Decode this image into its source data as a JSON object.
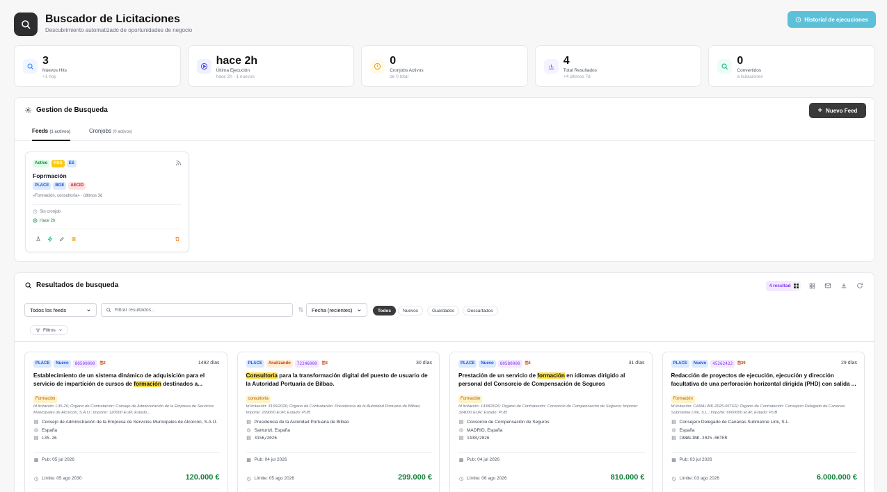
{
  "header": {
    "title": "Buscador de Licitaciones",
    "subtitle": "Descubrimiento automatizado de oportunidades de negocio",
    "history_button": "Historial de ejecuciones"
  },
  "stats": [
    {
      "value": "3",
      "label": "Nuevos Hits",
      "sub": "+1 hoy",
      "color": "#3b82f6",
      "bg": "#eff6ff"
    },
    {
      "value": "hace 2h",
      "label": "Última Ejecución",
      "sub": "hace 2h · 1 nuevos",
      "color": "#4f46e5",
      "bg": "#eef2ff"
    },
    {
      "value": "0",
      "label": "Cronjobs Activos",
      "sub": "de 0 total",
      "color": "#f59e0b",
      "bg": "#fffbeb"
    },
    {
      "value": "4",
      "label": "Total Resultados",
      "sub": "+4 últimos 7d",
      "color": "#8b5cf6",
      "bg": "#f5f3ff"
    },
    {
      "value": "0",
      "label": "Convertidos",
      "sub": "a licitaciones",
      "color": "#10b981",
      "bg": "#ecfdf5"
    }
  ],
  "gestion": {
    "title": "Gestion de Busqueda",
    "new_feed": "Nuevo Feed",
    "tabs": [
      {
        "label": "Feeds",
        "count": "(1 activos)"
      },
      {
        "label": "Cronjobs",
        "count": "(0 activos)"
      }
    ],
    "feed": {
      "status": "Activo",
      "type": "RSS",
      "lang": "ES",
      "name": "Foprmación",
      "sources": [
        "PLACE",
        "BOE",
        "AECID"
      ],
      "query": "«Formación, consultoría» · últimos 3d",
      "cron": "Sin cronjob",
      "last_run": "Hace 2h"
    }
  },
  "results": {
    "title": "Resultados de busqueda",
    "count_badge": "4 resultados",
    "feed_select": "Todos los feeds",
    "search_placeholder": "Filtrar resultados...",
    "sort_select": "Fecha (recientes)",
    "filters": [
      "Todos",
      "Nuevos",
      "Guardados",
      "Descartados"
    ],
    "filtros_label": "Filtros",
    "cards": [
      {
        "source": "PLACE",
        "status": "Nuevo",
        "code": "80500000",
        "docs": "2",
        "days": "1492 días",
        "title_pre": "Establecimiento de un sistema dinámico de adquisición para el servicio de impartición de cursos de ",
        "title_hl": "formación",
        "title_post": " destinados a...",
        "hl_first": false,
        "tag": "Formación",
        "desc": "Id licitación: L35-26; Órgano de Contratación: Consejo de Administración de la Empresa de Servicios Municipales de Alcorcón, S.A.U.; Importe: 120000 EUR; Estado...",
        "organ": "Consejo de Administración de la Empresa de Servicios Municipales de Alcorcón, S.A.U.",
        "location": "España",
        "ref": "L35-26",
        "pub": "Pub: 05 jul 2026",
        "limit": "Límite: 05 ago 2030",
        "amount": "120.000 €"
      },
      {
        "source": "PLACE",
        "status": "Analizando",
        "code": "72246000",
        "docs": "3",
        "days": "30 días",
        "title_pre": "",
        "title_hl": "Consultoría",
        "title_post": " para la transformación digital del puesto de usuario de la Autoridad Portuaria de Bilbao.",
        "hl_first": true,
        "tag": "consultoría",
        "desc": "Id licitación: 3156/2026; Órgano de Contratación: Presidencia de la Autoridad Portuaria de Bilbao; Importe: 299000 EUR; Estado: PUB",
        "organ": "Presidencia de la Autoridad Portuaria de Bilbao",
        "location": "Santurtzi, España",
        "ref": "3156/2026",
        "pub": "Pub: 04 jul 2026",
        "limit": "Límite: 05 ago 2026",
        "amount": "299.000 €"
      },
      {
        "source": "PLACE",
        "status": "Nuevo",
        "code": "80580000",
        "docs": "4",
        "days": "31 días",
        "title_pre": "Prestación de un servicio de ",
        "title_hl": "formación",
        "title_post": " en idiomas dirigido al personal del Consorcio de Compensación de Seguros",
        "hl_first": false,
        "tag": "Formación",
        "desc": "Id licitación: 1438/2026; Órgano de Contratación: Consorcio de Compensación de Seguros; Importe: 324000 EUR; Estado: PUB",
        "organ": "Consorcio de Compensación de Seguros",
        "location": "MADRID, España",
        "ref": "1438/2026",
        "pub": "Pub: 04 jul 2026",
        "limit": "Límite: 06 ago 2026",
        "amount": "810.000 €"
      },
      {
        "source": "PLACE",
        "status": "Nuevo",
        "code": "45262422",
        "docs": "39",
        "days": "29 días",
        "title_pre": "Redacción de proyectos de ejecución, ejecución y dirección facultativa de una perforación horizontal dirigida (PHD) con salida ...",
        "title_hl": "",
        "title_post": "",
        "hl_first": false,
        "tag": "Formación",
        "desc": "Id licitación: CANALINK-2025-06TER; Órgano de Contratación: Consejero Delegado de Canarias Submarine Link, S.L.; Importe: 6000000 EUR; Estado: PUB",
        "organ": "Consejero Delegado de Canarias Submarine Link, S.L.",
        "location": "España",
        "ref": "CANALINK-2025-06TER",
        "pub": "Pub: 03 jul 2026",
        "limit": "Límite: 03 ago 2026",
        "amount": "6.000.000 €"
      }
    ],
    "docs_label": "Documentos"
  }
}
